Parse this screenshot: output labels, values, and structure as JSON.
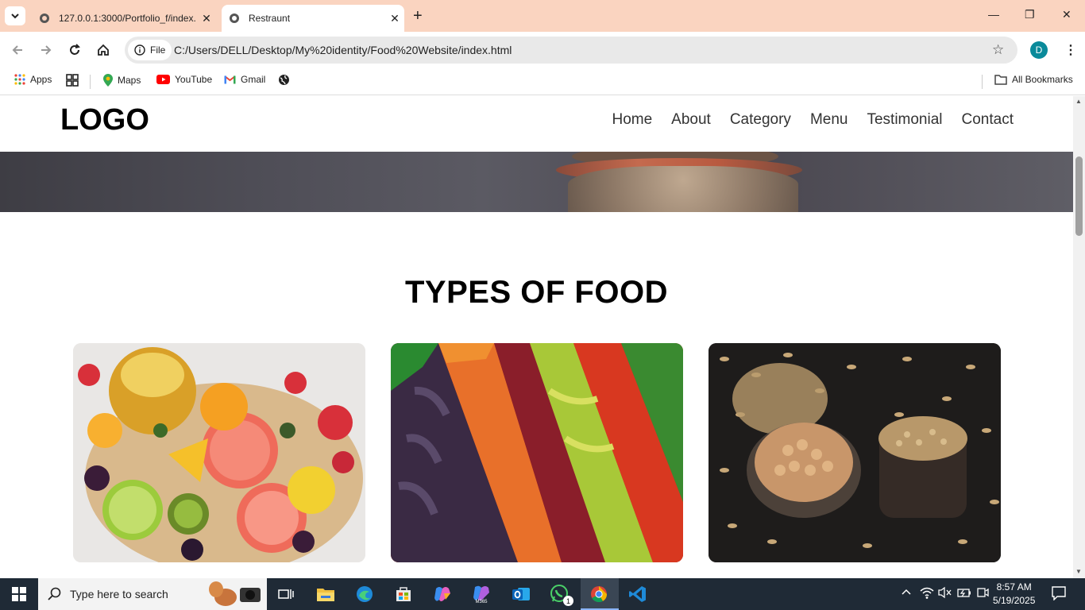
{
  "browser": {
    "tabs": [
      {
        "title": "127.0.0.1:3000/Portfolio_f/index.",
        "close": "✕"
      },
      {
        "title": "Restraunt",
        "close": "✕"
      }
    ],
    "new_tab": "+",
    "window_controls": {
      "minimize": "—",
      "restore": "❐",
      "close": "✕"
    },
    "address": {
      "chip_label": "File",
      "url": "C:/Users/DELL/Desktop/My%20identity/Food%20Website/index.html"
    },
    "profile_initial": "D",
    "bookmarks": [
      {
        "label": "Apps",
        "icon": "apps-grid-icon"
      },
      {
        "label": "",
        "icon": "tab-groups-icon"
      },
      {
        "label": "Maps",
        "icon": "maps-pin-icon"
      },
      {
        "label": "YouTube",
        "icon": "youtube-icon"
      },
      {
        "label": "Gmail",
        "icon": "gmail-icon"
      },
      {
        "label": "",
        "icon": "globe-icon"
      }
    ],
    "all_bookmarks": "All Bookmarks"
  },
  "site": {
    "logo": "LOGO",
    "nav": [
      "Home",
      "About",
      "Category",
      "Menu",
      "Testimonial",
      "Contact"
    ],
    "section_title": "TYPES OF FOOD",
    "cards": [
      {
        "name": "fruits-card",
        "image": "fruit-platter-image"
      },
      {
        "name": "vegetables-card",
        "image": "vegetable-market-image"
      },
      {
        "name": "grains-card",
        "image": "chickpeas-oats-image"
      }
    ]
  },
  "taskbar": {
    "search_placeholder": "Type here to search",
    "time": "8:57 AM",
    "date": "5/19/2025",
    "whatsapp_badge": "1"
  },
  "colors": {
    "tab_strip": "#fad4c0",
    "taskbar": "#1f2a36",
    "profile": "#0a8a9a"
  }
}
